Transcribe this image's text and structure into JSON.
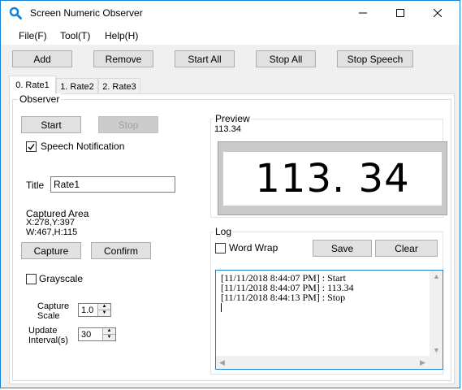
{
  "window": {
    "title": "Screen Numeric Observer"
  },
  "menu": [
    "File(F)",
    "Tool(T)",
    "Help(H)"
  ],
  "toolbar": {
    "add": "Add",
    "remove": "Remove",
    "start_all": "Start All",
    "stop_all": "Stop All",
    "stop_speech": "Stop Speech"
  },
  "tabs": [
    "0. Rate1",
    "1. Rate2",
    "2. Rate3"
  ],
  "observer": {
    "group_label": "Observer",
    "start": "Start",
    "stop": "Stop",
    "speech_notification": "Speech Notification",
    "speech_checked": true,
    "title_label": "Title",
    "title_value": "Rate1",
    "captured_area_label": "Captured Area",
    "captured_area_pos": "X:278,Y:397",
    "captured_area_size": "W:467,H:115",
    "capture": "Capture",
    "confirm": "Confirm",
    "grayscale": "Grayscale",
    "grayscale_checked": false,
    "capture_scale_line1": "Capture",
    "capture_scale_line2": "Scale",
    "capture_scale_value": "1.0",
    "update_interval_line1": "Update",
    "update_interval_line2": "Interval(s)",
    "update_interval_value": "30"
  },
  "preview": {
    "label": "Preview",
    "value_text": "113.34",
    "display": "113. 34"
  },
  "log": {
    "label": "Log",
    "word_wrap": "Word Wrap",
    "word_wrap_checked": false,
    "save": "Save",
    "clear": "Clear",
    "lines": [
      "[11/11/2018 8:44:07 PM] : Start",
      "[11/11/2018 8:44:07 PM] : 113.34",
      "[11/11/2018 8:44:13 PM] : Stop"
    ]
  },
  "colors": {
    "accent": "#1883d7",
    "window_bg": "#f0f0f0",
    "button_bg": "#e1e1e1"
  }
}
